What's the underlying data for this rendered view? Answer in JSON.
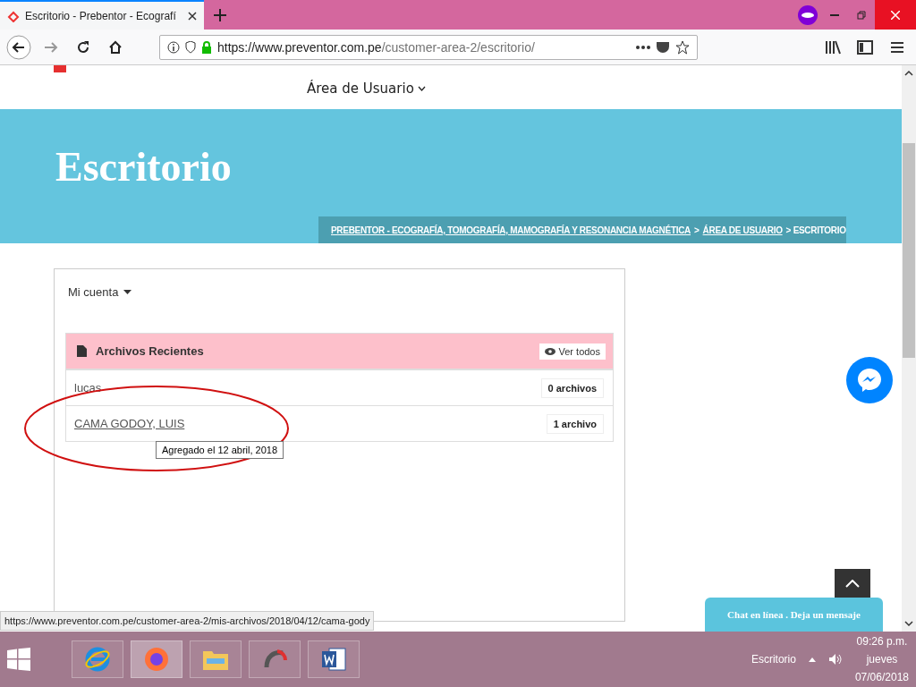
{
  "browser": {
    "tab_title": "Escritorio - Prebentor - Ecografí",
    "url_host": "https://www.preventor.com.pe",
    "url_path": "/customer-area-2/escritorio/"
  },
  "nav": {
    "menu": "Área de Usuario"
  },
  "banner": {
    "title": "Escritorio",
    "breadcrumb": [
      {
        "label": "PREBENTOR - ECOGRAFÍA, TOMOGRAFÍA, MAMOGRAFÍA Y RESONANCIA MAGNÉTICA",
        "link": true
      },
      {
        "label": ">",
        "link": false
      },
      {
        "label": "ÁREA DE USUARIO",
        "link": true
      },
      {
        "label": "> ESCRITORIO",
        "link": false
      }
    ]
  },
  "account_menu": "Mi cuenta",
  "recent_files": {
    "title": "Archivos Recientes",
    "view_all": "Ver todos",
    "rows": [
      {
        "name": "lucas",
        "link": false,
        "count": "0 archivos"
      },
      {
        "name": "CAMA GODOY, LUIS",
        "link": true,
        "count": "1 archivo"
      }
    ]
  },
  "tooltip": "Agregado el 12 abril, 2018",
  "chat": "Chat en línea . Deja un mensaje",
  "status_url": "https://www.preventor.com.pe/customer-area-2/mis-archivos/2018/04/12/cama-gody",
  "taskbar": {
    "desktop": "Escritorio",
    "time": "09:26 p.m.",
    "day": "jueves",
    "date": "07/06/2018"
  }
}
